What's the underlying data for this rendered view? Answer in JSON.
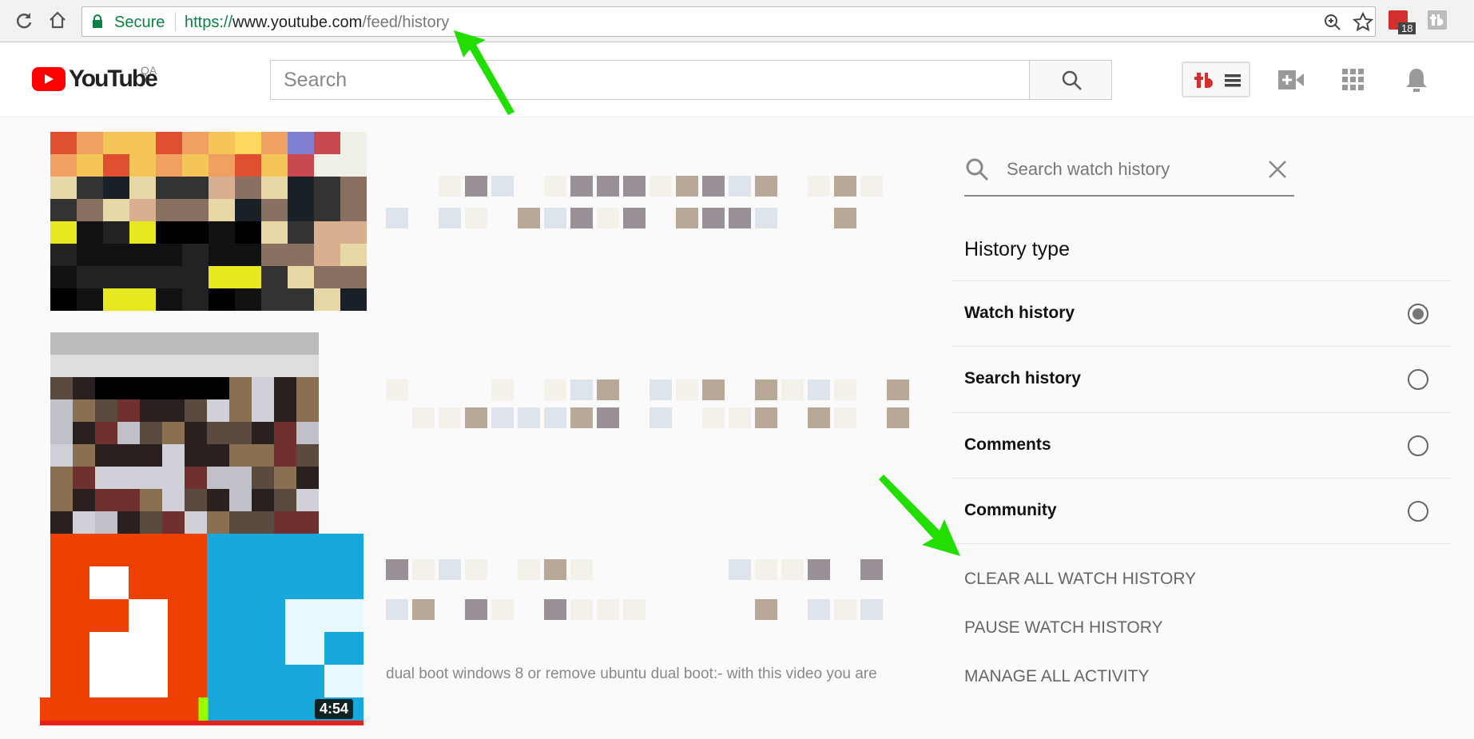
{
  "browser": {
    "secure_label": "Secure",
    "url_scheme": "https://",
    "url_host": "www.youtube.com",
    "url_path": "/feed/history",
    "extension_badge": "18"
  },
  "header": {
    "logo_text": "YouTube",
    "logo_region": "QA",
    "search_placeholder": "Search"
  },
  "videos": [
    {
      "duration": ""
    },
    {
      "duration": ""
    },
    {
      "duration": "4:54",
      "description": "dual boot windows 8 or remove ubuntu dual boot:- with this video you are"
    }
  ],
  "panel": {
    "search_placeholder": "Search watch history",
    "history_type_title": "History type",
    "options": [
      {
        "label": "Watch history",
        "selected": true
      },
      {
        "label": "Search history",
        "selected": false
      },
      {
        "label": "Comments",
        "selected": false
      },
      {
        "label": "Community",
        "selected": false
      }
    ],
    "actions": [
      "Clear all watch history",
      "Pause watch history",
      "Manage all activity"
    ]
  },
  "colors": {
    "brand": "#ff0000",
    "annotation_arrow": "#22dd00"
  }
}
